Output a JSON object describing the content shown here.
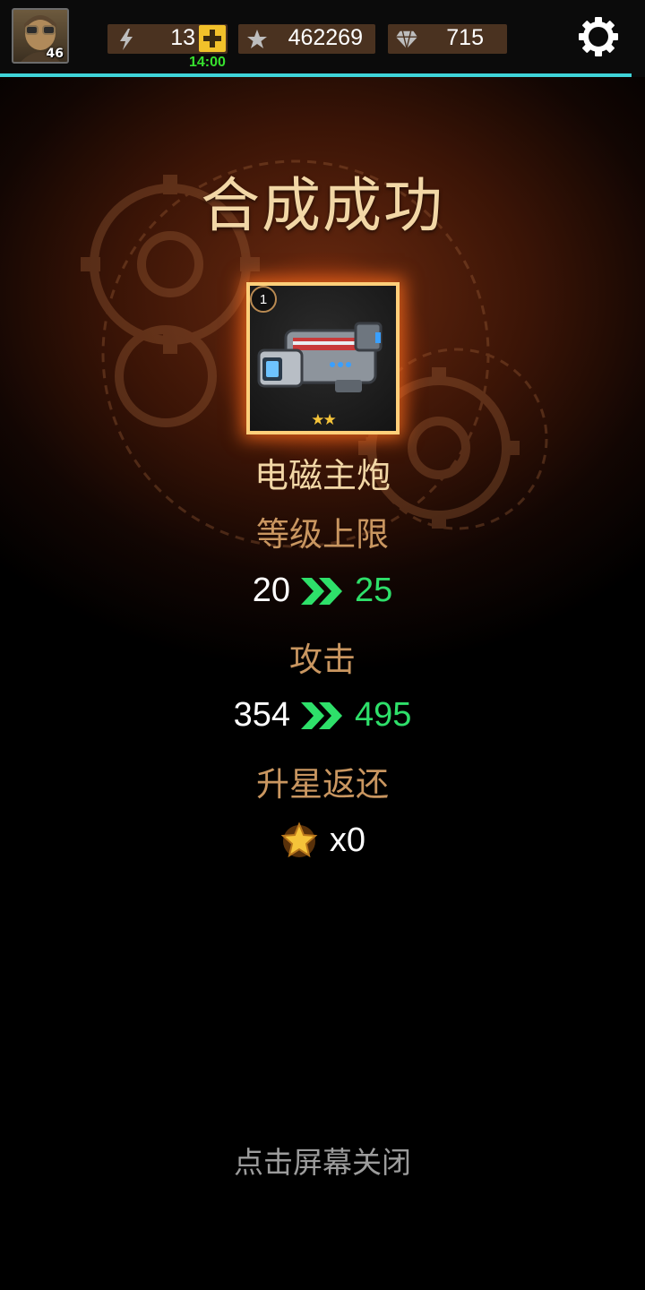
{
  "header": {
    "player_level": "46",
    "energy": {
      "value": "13",
      "timer": "14:00"
    },
    "stars": {
      "value": "462269"
    },
    "gems": {
      "value": "715"
    }
  },
  "result": {
    "title": "合成成功",
    "item": {
      "name": "电磁主炮",
      "badge": "1",
      "stars_display": "★★",
      "star_count": 2
    },
    "level_cap": {
      "label": "等级上限",
      "from": "20",
      "to": "25"
    },
    "attack": {
      "label": "攻击",
      "from": "354",
      "to": "495"
    },
    "refund": {
      "label": "升星返还",
      "count": "x0"
    }
  },
  "footer": {
    "close_hint": "点击屏幕关闭"
  },
  "colors": {
    "title": "#f2d7a6",
    "label": "#c99660",
    "increase": "#2ee06a",
    "accent_line": "#3fd4d8",
    "resource_bg": "#4a3220",
    "plus_button": "#f2c12a"
  }
}
